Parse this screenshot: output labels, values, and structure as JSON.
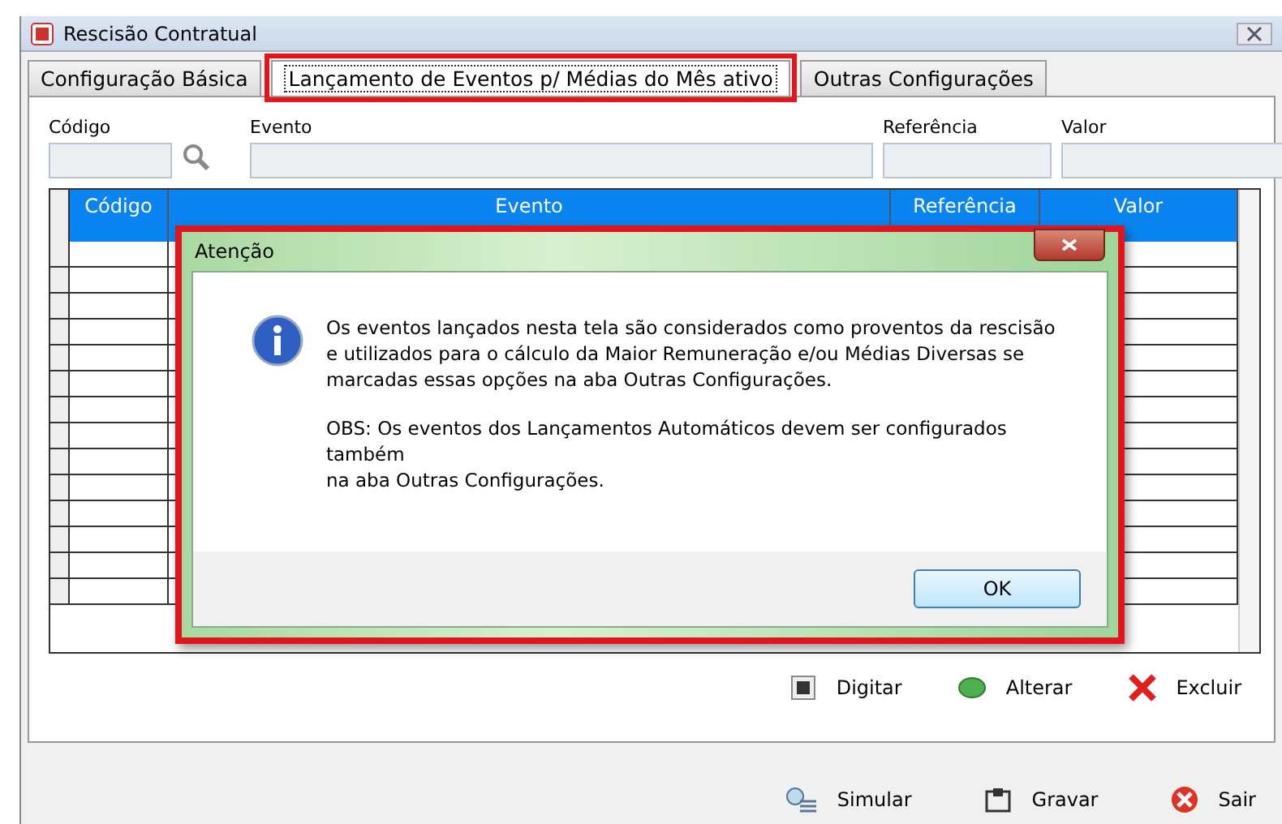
{
  "window": {
    "title": "Rescisão Contratual"
  },
  "tabs": [
    {
      "label": "Configuração Básica",
      "selected": false
    },
    {
      "label": "Lançamento de Eventos p/ Médias do Mês ativo",
      "selected": true
    },
    {
      "label": "Outras Configurações",
      "selected": false
    }
  ],
  "fields": [
    {
      "label": "Código"
    },
    {
      "label": "Evento"
    },
    {
      "label": "Referência"
    },
    {
      "label": "Valor"
    }
  ],
  "table": {
    "columns": [
      "Código",
      "Evento",
      "Referência",
      "Valor"
    ]
  },
  "actions": [
    {
      "kind": "type",
      "label": "Digitar"
    },
    {
      "kind": "edit",
      "label": "Alterar"
    },
    {
      "kind": "delete",
      "label": "Excluir"
    }
  ],
  "footer_buttons": [
    {
      "kind": "simulate",
      "label": "Simular"
    },
    {
      "kind": "save",
      "label": "Gravar"
    },
    {
      "kind": "exit",
      "label": "Sair"
    }
  ],
  "dialog": {
    "title": "Atenção",
    "message": "Os eventos lançados nesta tela são considerados como proventos da rescisão e utilizados para o cálculo da Maior Remuneração e/ou Médias Diversas se marcadas essas opções na aba Outras Configurações.",
    "note_lines": [
      "OBS: Os eventos dos Lançamentos Automáticos devem ser configurados também",
      "na aba Outras Configurações."
    ],
    "button": "OK"
  }
}
